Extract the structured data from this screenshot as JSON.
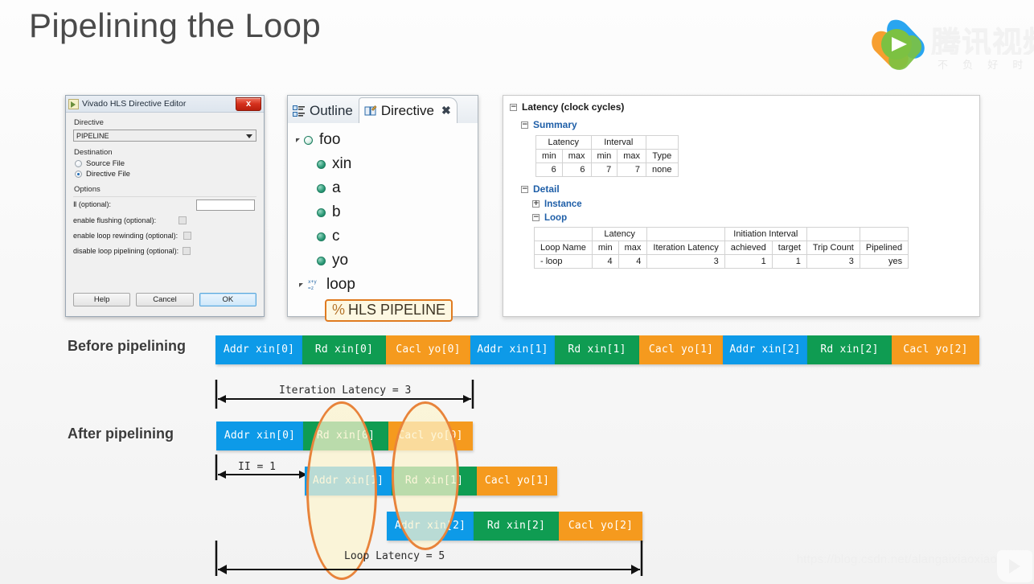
{
  "slide": {
    "title": "Pipelining the Loop",
    "watermark": "https://blog.csdn.net/alangaixiaoxiao"
  },
  "logo": {
    "brand_cn": "腾讯视频",
    "tagline_cn": "不 负 好 时 光",
    "accent_green": "#7cc142",
    "accent_blue": "#29a5f0",
    "accent_orange": "#f79a25"
  },
  "directive_dialog": {
    "title": "Vivado HLS Directive Editor",
    "close_label": "x",
    "directive_label": "Directive",
    "directive_value": "PIPELINE",
    "destination_label": "Destination",
    "destination_options": [
      {
        "label": "Source File",
        "selected": false
      },
      {
        "label": "Directive File",
        "selected": true
      }
    ],
    "options_label": "Options",
    "ii_label": "Ⅱ (optional):",
    "ii_value": "",
    "checkboxes": [
      {
        "label": "enable flushing (optional):",
        "checked": false
      },
      {
        "label": "enable loop rewinding (optional):",
        "checked": false
      },
      {
        "label": "disable loop pipelining (optional):",
        "checked": false
      }
    ],
    "buttons": {
      "help": "Help",
      "cancel": "Cancel",
      "ok": "OK"
    }
  },
  "outline_view": {
    "tabs": [
      {
        "label": "Outline",
        "icon": "outline-icon",
        "active": false
      },
      {
        "label": "Directive",
        "icon": "directive-icon",
        "active": true
      }
    ],
    "close_label": "✖",
    "tree": [
      {
        "label": "foo",
        "kind": "function",
        "depth": 0,
        "twisty": true
      },
      {
        "label": "xin",
        "kind": "variable",
        "depth": 1,
        "twisty": false
      },
      {
        "label": "a",
        "kind": "variable",
        "depth": 1,
        "twisty": false
      },
      {
        "label": "b",
        "kind": "variable",
        "depth": 1,
        "twisty": false
      },
      {
        "label": "c",
        "kind": "variable",
        "depth": 1,
        "twisty": false
      },
      {
        "label": "yo",
        "kind": "variable",
        "depth": 1,
        "twisty": false
      },
      {
        "label": "loop",
        "kind": "loop",
        "depth": 0,
        "twisty": true
      }
    ],
    "directive_badge": {
      "prefix": "%",
      "text": "HLS PIPELINE",
      "border_color": "#e07b20"
    }
  },
  "latency_report": {
    "heading": "Latency (clock cycles)",
    "summary_heading": "Summary",
    "summary": {
      "group_headers": [
        "Latency",
        "Interval",
        ""
      ],
      "col_headers": [
        "min",
        "max",
        "min",
        "max",
        "Type"
      ],
      "row": [
        "6",
        "6",
        "7",
        "7",
        "none"
      ]
    },
    "detail_heading": "Detail",
    "instance_heading": "Instance",
    "loop_heading": "Loop",
    "loop_table": {
      "group_headers": [
        "",
        "Latency",
        "",
        "Initiation Interval",
        "",
        ""
      ],
      "col_headers": [
        "Loop Name",
        "min",
        "max",
        "Iteration Latency",
        "achieved",
        "target",
        "Trip Count",
        "Pipelined"
      ],
      "rows": [
        [
          "- loop",
          "4",
          "4",
          "3",
          "1",
          "1",
          "3",
          "yes"
        ]
      ]
    }
  },
  "timelines": {
    "before_label": "Before pipelining",
    "after_label": "After pipelining",
    "colors": {
      "addr": "#0d9ae8",
      "read": "#0f9c52",
      "calc": "#f59a1e"
    },
    "before_blocks": [
      {
        "text": "Addr xin[0]",
        "type": "addr"
      },
      {
        "text": "Rd xin[0]",
        "type": "read"
      },
      {
        "text": "Cacl yo[0]",
        "type": "calc"
      },
      {
        "text": "Addr xin[1]",
        "type": "addr"
      },
      {
        "text": "Rd xin[1]",
        "type": "read"
      },
      {
        "text": "Cacl yo[1]",
        "type": "calc"
      },
      {
        "text": "Addr xin[2]",
        "type": "addr"
      },
      {
        "text": "Rd xin[2]",
        "type": "read"
      },
      {
        "text": "Cacl yo[2]",
        "type": "calc"
      }
    ],
    "after_rows": [
      [
        {
          "text": "Addr xin[0]",
          "type": "addr"
        },
        {
          "text": "Rd xin[0]",
          "type": "read"
        },
        {
          "text": "Cacl yo[0]",
          "type": "calc"
        }
      ],
      [
        {
          "text": "Addr xin[1]",
          "type": "addr"
        },
        {
          "text": "Rd xin[1]",
          "type": "read"
        },
        {
          "text": "Cacl yo[1]",
          "type": "calc"
        }
      ],
      [
        {
          "text": "Addr xin[2]",
          "type": "addr"
        },
        {
          "text": "Rd xin[2]",
          "type": "read"
        },
        {
          "text": "Cacl yo[2]",
          "type": "calc"
        }
      ]
    ],
    "annotations": {
      "iteration_latency": "Iteration Latency = 3",
      "ii": "II = 1",
      "loop_latency": "Loop Latency = 5"
    }
  }
}
